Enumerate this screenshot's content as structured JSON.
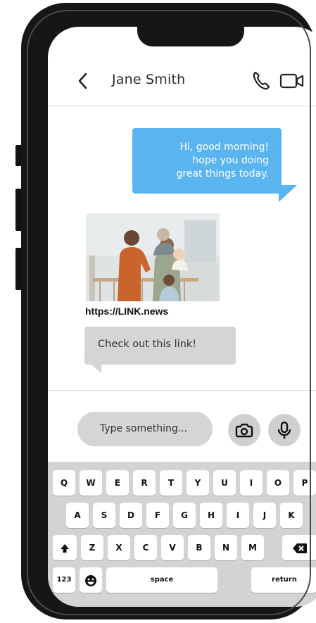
{
  "header": {
    "contact_name": "Jane Smith",
    "back_icon": "chevron-left-icon",
    "call_icon": "phone-icon",
    "video_icon": "video-camera-icon"
  },
  "messages": {
    "outgoing": {
      "lines": [
        "Hi, good morning!",
        "hope you doing",
        "great things today."
      ],
      "color": "#5ab4ef"
    },
    "shared_link": {
      "image_description_icon": "family-photo",
      "url": "https://LINK.news"
    },
    "incoming": {
      "text": "Check out this link!",
      "color": "#d5d5d5"
    }
  },
  "composer": {
    "placeholder": "Type something...",
    "camera_icon": "camera-icon",
    "mic_icon": "microphone-icon"
  },
  "keyboard": {
    "row1": [
      "Q",
      "W",
      "E",
      "R",
      "T",
      "Y",
      "U",
      "I",
      "O",
      "P"
    ],
    "row2": [
      "A",
      "S",
      "D",
      "F",
      "G",
      "H",
      "I",
      "J",
      "K"
    ],
    "row3": [
      "Z",
      "X",
      "C",
      "V",
      "B",
      "N",
      "M"
    ],
    "numbers_key": "123",
    "space_key": "space",
    "return_key": "return"
  }
}
